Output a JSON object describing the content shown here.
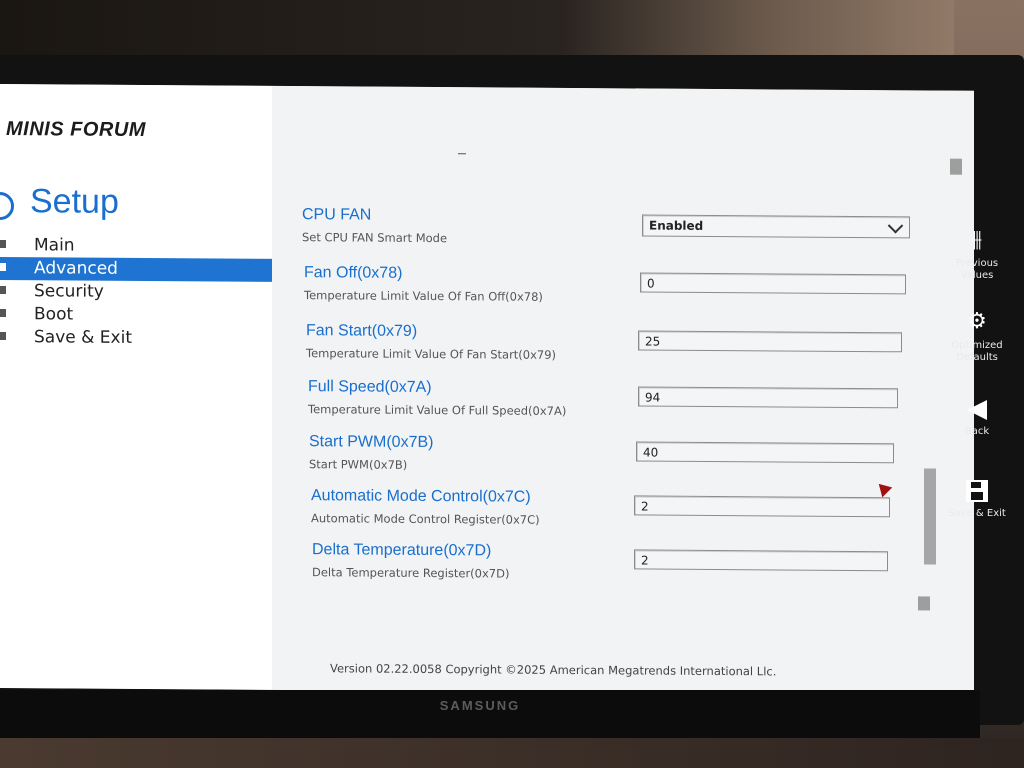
{
  "brand": "MINIS FORUM",
  "setup_title": "Setup",
  "menu": [
    {
      "label": "Main"
    },
    {
      "label": "Advanced"
    },
    {
      "label": "Security"
    },
    {
      "label": "Boot"
    },
    {
      "label": "Save & Exit"
    }
  ],
  "settings": [
    {
      "label": "CPU FAN",
      "help": "Set CPU FAN Smart Mode",
      "value": "Enabled"
    },
    {
      "label": "Fan Off(0x78)",
      "help": "Temperature Limit Value Of Fan Off(0x78)",
      "value": "0"
    },
    {
      "label": "Fan Start(0x79)",
      "help": "Temperature Limit Value Of Fan Start(0x79)",
      "value": "25"
    },
    {
      "label": "Full Speed(0x7A)",
      "help": "Temperature Limit Value Of Full Speed(0x7A)",
      "value": "94"
    },
    {
      "label": "Start PWM(0x7B)",
      "help": "Start PWM(0x7B)",
      "value": "40"
    },
    {
      "label": "Automatic Mode Control(0x7C)",
      "help": "Automatic Mode Control Register(0x7C)",
      "value": "2"
    },
    {
      "label": "Delta Temperature(0x7D)",
      "help": "Delta Temperature Register(0x7D)",
      "value": "2"
    }
  ],
  "footer": "Version 02.22.0058 Copyright ©2025 American Megatrends International Llc.",
  "function_bar": [
    {
      "label_line1": "Previous",
      "label_line2": "Values",
      "icon": "sliders-icon"
    },
    {
      "label_line1": "Optimized",
      "label_line2": "Defaults",
      "icon": "gear-icon"
    },
    {
      "label_line1": "Back",
      "label_line2": "",
      "icon": "back-arrow-icon"
    },
    {
      "label_line1": "Save & Exit",
      "label_line2": "",
      "icon": "floppy-disk-icon"
    }
  ],
  "monitor_brand": "SAMSUNG",
  "colors": {
    "accent": "#1a6fce",
    "selected_bg": "#1f74d1"
  }
}
